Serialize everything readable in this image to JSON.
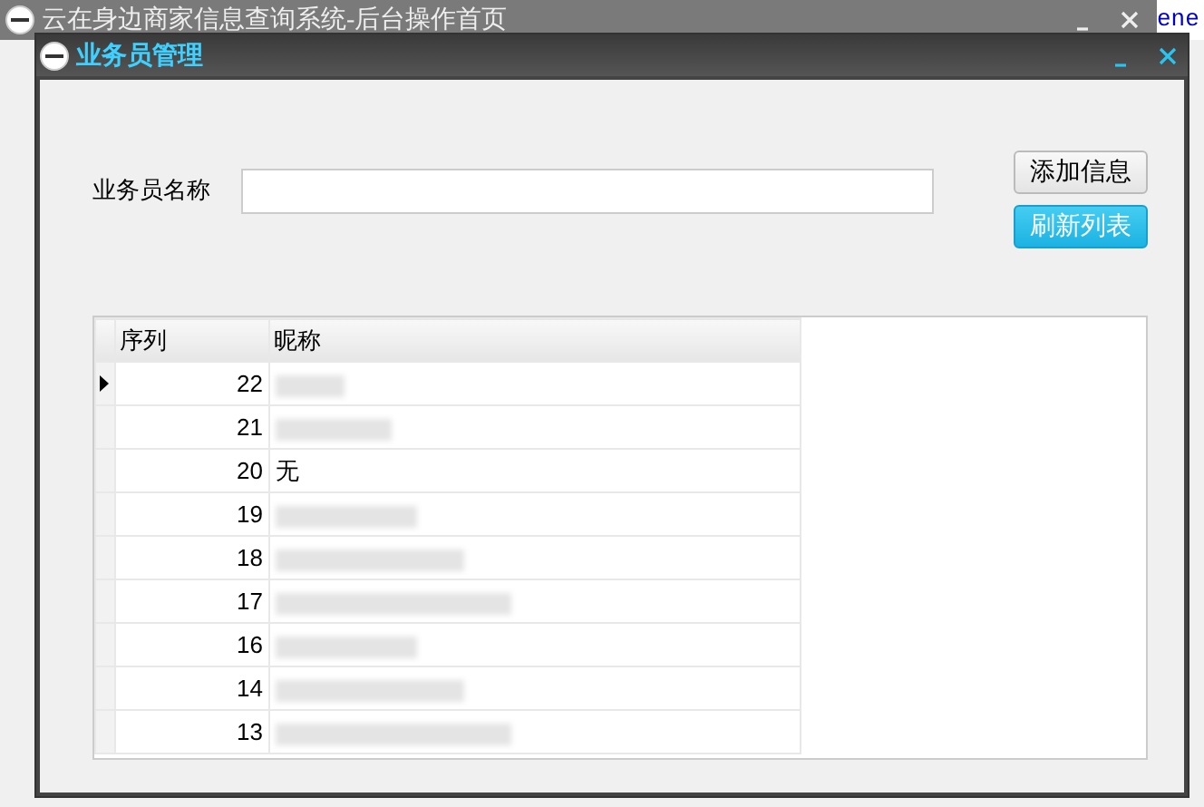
{
  "main_window": {
    "title": "云在身边商家信息查询系统-后台操作首页",
    "edge_text": "ene"
  },
  "window": {
    "title": "业务员管理"
  },
  "form": {
    "label": "业务员名称"
  },
  "buttons": [
    {
      "label": "添加信息",
      "kind": "plain"
    },
    {
      "label": "刷新列表",
      "kind": "primary"
    }
  ],
  "table": {
    "columns": [
      "序列",
      "昵称"
    ],
    "rows": [
      {
        "id": "22",
        "current": true,
        "redacted": true
      },
      {
        "id": "21",
        "current": false,
        "redacted": true
      },
      {
        "id": "20",
        "current": false,
        "nickname": "无"
      },
      {
        "id": "19",
        "current": false,
        "redacted": true
      },
      {
        "id": "18",
        "current": false,
        "redacted": true
      },
      {
        "id": "17",
        "current": false,
        "redacted": true
      },
      {
        "id": "16",
        "current": false,
        "redacted": true
      },
      {
        "id": "14",
        "current": false,
        "redacted": true
      },
      {
        "id": "13",
        "current": false,
        "redacted": true
      }
    ]
  }
}
